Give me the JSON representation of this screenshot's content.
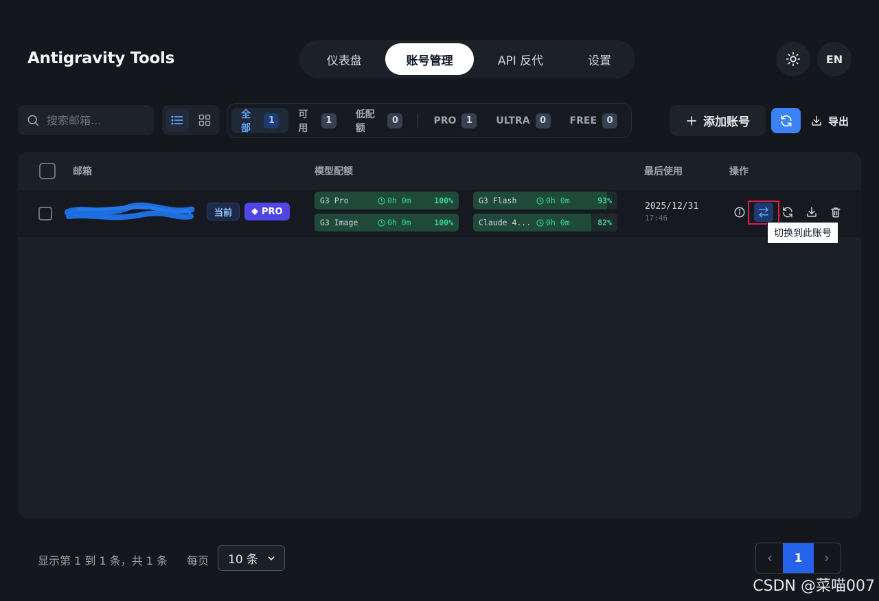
{
  "app": {
    "title": "Antigravity Tools"
  },
  "nav": {
    "tabs": [
      {
        "label": "仪表盘"
      },
      {
        "label": "账号管理",
        "active": true
      },
      {
        "label": "API 反代"
      },
      {
        "label": "设置"
      }
    ],
    "theme_icon": "sun-icon",
    "language": "EN"
  },
  "toolbar": {
    "search_placeholder": "搜索邮箱...",
    "view_mode": "list",
    "filters": [
      {
        "label": "全部",
        "count": "1",
        "active": true
      },
      {
        "label": "可用",
        "count": "1"
      },
      {
        "label": "低配额",
        "count": "0"
      },
      {
        "label": "PRO",
        "count": "1"
      },
      {
        "label": "ULTRA",
        "count": "0"
      },
      {
        "label": "FREE",
        "count": "0"
      }
    ],
    "add_label": "添加账号",
    "export_label": "导出"
  },
  "table": {
    "headers": {
      "email": "邮箱",
      "quota": "模型配额",
      "last_used": "最后使用",
      "actions": "操作"
    },
    "rows": [
      {
        "email": "",
        "tag_current": "当前",
        "tag_plan": "PRO",
        "quotas": [
          {
            "name": "G3 Pro",
            "reset": "0h 0m",
            "percent": "100%",
            "level": 1.0
          },
          {
            "name": "G3 Flash",
            "reset": "0h 0m",
            "percent": "93%",
            "level": 0.93
          },
          {
            "name": "G3 Image",
            "reset": "0h 0m",
            "percent": "100%",
            "level": 1.0
          },
          {
            "name": "Claude 4...",
            "reset": "0h 0m",
            "percent": "82%",
            "level": 0.82
          }
        ],
        "last_used_date": "2025/12/31",
        "last_used_time": "17:46"
      }
    ],
    "tooltip": "切换到此账号"
  },
  "footer": {
    "summary": "显示第 1 到 1 条，共 1 条",
    "per_page_label": "每页",
    "per_page_value": "10 条",
    "current_page": "1"
  },
  "watermark": "CSDN @菜喵007",
  "colors": {
    "accent": "#3b82f6",
    "quota_green": "#34d399",
    "pro_badge": "#4f46e5",
    "highlight": "#e11d48"
  }
}
